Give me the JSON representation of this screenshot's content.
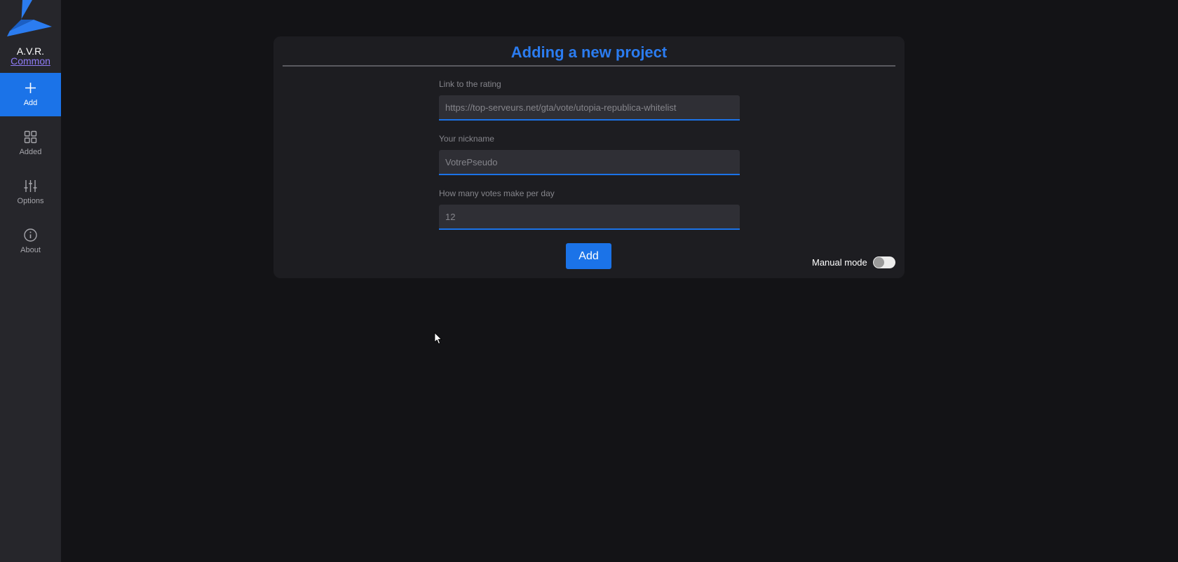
{
  "sidebar": {
    "brand": "A.V.R.",
    "brand_link": "Common",
    "items": [
      {
        "label": "Add",
        "icon": "plus-icon",
        "active": true
      },
      {
        "label": "Added",
        "icon": "grid-icon",
        "active": false
      },
      {
        "label": "Options",
        "icon": "sliders-icon",
        "active": false
      },
      {
        "label": "About",
        "icon": "info-icon",
        "active": false
      }
    ]
  },
  "form": {
    "title": "Adding a new project",
    "link": {
      "label": "Link to the rating",
      "placeholder": "https://top-serveurs.net/gta/vote/utopia-republica-whitelist"
    },
    "nickname": {
      "label": "Your nickname",
      "placeholder": "VotrePseudo"
    },
    "votes": {
      "label": "How many votes make per day",
      "placeholder": "12"
    },
    "add_label": "Add",
    "manual_mode_label": "Manual mode",
    "manual_mode_on": false
  },
  "colors": {
    "accent": "#1b73e8",
    "title": "#2b7cf0",
    "background": "#131316",
    "sidebar": "#26262b",
    "card": "#1d1d21"
  }
}
